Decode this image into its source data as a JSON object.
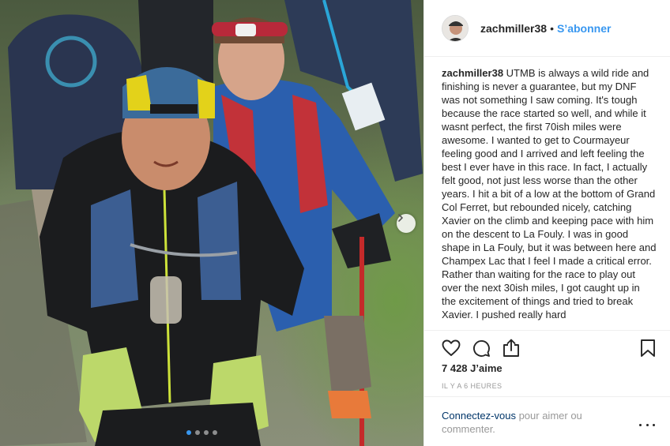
{
  "post": {
    "username": "zachmiller38",
    "separator": "•",
    "follow_label": "S’abonner",
    "caption_user": "zachmiller38",
    "caption_text": " UTMB is always a wild ride and finishing is never a guarantee, but my DNF was not something I saw coming.  It's tough because the race started so well, and while it wasnt perfect, the first 70ish miles were awesome.  I wanted to get to Courmayeur feeling good and I arrived and left feeling the best I ever have in this race.  In fact, I actually felt good, not just less worse than the other years.  I hit a bit of a low at the bottom of Grand Col Ferret, but rebounded nicely, catching Xavier on the climb and keeping pace with him on the descent to La Fouly. I was in good shape in La Fouly, but it was between here and Champex Lac that I feel I made a critical error. Rather than waiting for the race to play out over the next 30ish miles, I got caught up in the excitement of things and tried to break Xavier. I pushed really hard",
    "likes": "7 428 J’aime",
    "timestamp": "IL Y A 6 HEURES"
  },
  "login_prompt": {
    "link": "Connectez-vous",
    "text": " pour aimer ou commenter."
  },
  "carousel": {
    "total_slides": 4,
    "active_slide": 1
  },
  "icons": {
    "like": "heart-icon",
    "comment": "comment-icon",
    "share": "share-icon",
    "save": "bookmark-icon",
    "next": "chevron-right-icon",
    "more": "more-options-icon"
  },
  "colors": {
    "link_blue": "#3897f0",
    "login_link": "#003569",
    "muted": "#999999",
    "text": "#262626"
  }
}
